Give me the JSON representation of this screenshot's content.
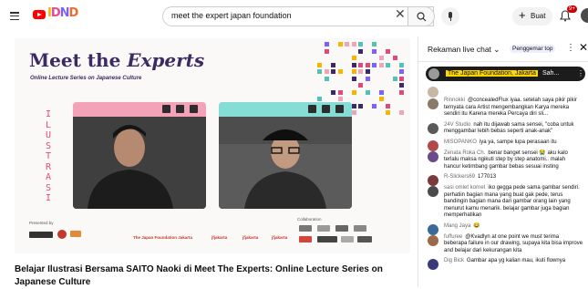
{
  "header": {
    "search_query": "meet the expert japan foundation",
    "create_label": "Buat",
    "notification_count": "9+"
  },
  "video": {
    "title_part1": "Meet the ",
    "title_part2": "Experts",
    "subtitle": "Online Lecture Series on Japanese Culture",
    "vertical_text": [
      "I",
      "L",
      "U",
      "S",
      "T",
      "R",
      "A",
      "S",
      "I"
    ],
    "presented_by": "Presented by",
    "collaboration": "Collaboration",
    "footer_links": [
      "The Japan Foundation Jakarta",
      "jfjakarta",
      "jfjakarta",
      "jfjakarta"
    ]
  },
  "video_title": "Belajar Ilustrasi Bersama SAITO Naoki di Meet The Experts: Online Lecture Series on Japanese Culture",
  "chat": {
    "mode_label": "Rekaman live chat",
    "sponsor_label": "Penggemar top",
    "pinned": {
      "author": "The Japan Foundation, Jakarta",
      "message": "Sah..."
    },
    "messages": [
      {
        "author": "",
        "text": "",
        "color": "#c9b7a6"
      },
      {
        "author": "Rinnokki",
        "text": "@concealedFlux iyaa. setelah saya pikir pikir ternyata cara Artist mengembangkan Karya mereka sendiri itu Karena mereka Percaya diri sli...",
        "color": "#8a7a6a"
      },
      {
        "author": "24V Studio",
        "text": "nah itu dijawab sama sensei, \"coba untuk menggambar lebih bebas seperti anak-anak\"",
        "color": "#5a5a5a"
      },
      {
        "author": "MISOPANKO",
        "text": "iya ya, sampe lupa perasaan itu",
        "color": "#b04a4a"
      },
      {
        "author": "Zenata Roka Ch.",
        "text": "benar banget sensei 😭 aku kalo terlalu maksa ngikuti step by step anatomi.. malah hancur ketimbang gambar bebas sesuai insting",
        "color": "#6a4a8a"
      },
      {
        "author": "R-Slickers69",
        "text": "177013",
        "color": "#7a3a3a"
      },
      {
        "author": "sasi omlet kornet",
        "text": "iko gegga pede sama gambar sendiri. perhatiin bagian mana yang buat gak pede, terus bandingin bagian mana dari gambar orang lain yang menurut kamu menarik. belajar gambar juga bagian memperhatikan",
        "color": "#4a4a4a"
      },
      {
        "author": "Mang Jaya",
        "text": "😂",
        "color": "#3a6a9a"
      },
      {
        "author": "fuffuree",
        "text": "@Kvadlyn at one point we must terima beberapa failure in our drawing, supaya kita bisa improve and belajar dari kekurangan kita",
        "color": "#9a6a4a"
      },
      {
        "author": "Dig Bick",
        "text": "Gambar apa yg kalian mau, ikuti flownya",
        "color": "#3a3a7a"
      }
    ]
  }
}
